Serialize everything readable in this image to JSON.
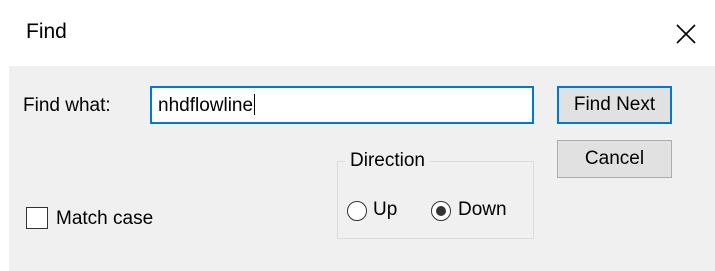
{
  "dialog": {
    "title": "Find",
    "find_label": "Find what:",
    "find_value": "nhdflowline",
    "find_next_label": "Find Next",
    "cancel_label": "Cancel",
    "direction_label": "Direction",
    "up_label": "Up",
    "down_label": "Down",
    "match_case_label": "Match case",
    "direction_selected": "Down",
    "match_case_checked": false
  },
  "icons": {
    "close": "close-icon"
  },
  "colors": {
    "accent": "#0078d7",
    "background": "#f0f0f0",
    "button": "#e1e1e1"
  }
}
